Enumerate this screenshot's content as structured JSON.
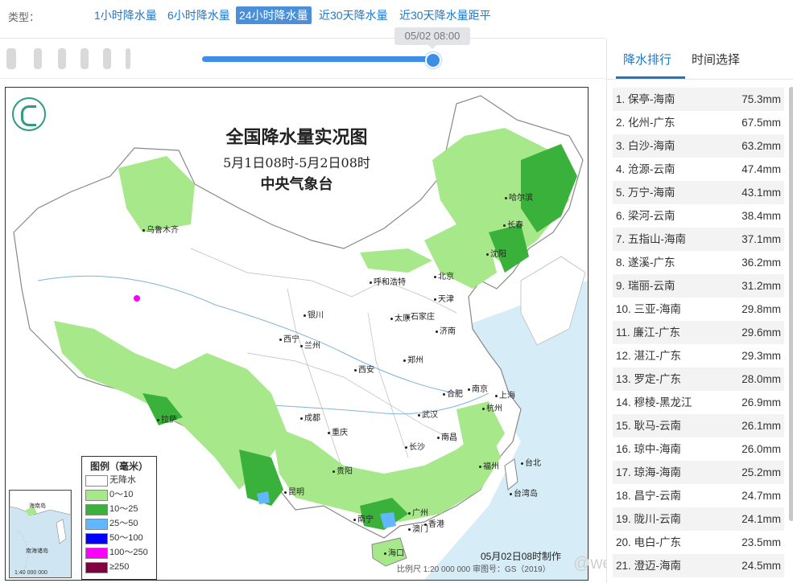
{
  "filter": {
    "type_label": "类型：",
    "tabs": [
      {
        "label": "1小时降水量",
        "active": false
      },
      {
        "label": "6小时降水量",
        "active": false
      },
      {
        "label": "24小时降水量",
        "active": true
      },
      {
        "label": "近30天降水量",
        "active": false
      },
      {
        "label": "近30天降水量距平",
        "active": false
      }
    ]
  },
  "timeline": {
    "selected_time": "05/02 08:00",
    "position_fraction": 1.0
  },
  "map": {
    "title": "全国降水量实况图",
    "period": "5月1日08时-5月2日08时",
    "issuer": "中央气象台",
    "cities": [
      "乌鲁木齐",
      "哈尔滨",
      "长春",
      "沈阳",
      "北京",
      "天津",
      "呼和浩特",
      "银川",
      "太原",
      "石家庄",
      "济南",
      "西宁",
      "兰州",
      "郑州",
      "西安",
      "合肥",
      "南京",
      "上海",
      "杭州",
      "成都",
      "武汉",
      "重庆",
      "南昌",
      "拉萨",
      "长沙",
      "贵阳",
      "福州",
      "台北",
      "昆明",
      "南宁",
      "广州",
      "香港",
      "澳门",
      "海口",
      "台湾岛"
    ],
    "legend_title": "图例（毫米）",
    "legend": [
      {
        "label": "无降水",
        "color": "#ffffff"
      },
      {
        "label": "0～10",
        "color": "#a6e88a"
      },
      {
        "label": "10～25",
        "color": "#39b13a"
      },
      {
        "label": "25～50",
        "color": "#62b8ff"
      },
      {
        "label": "50～100",
        "color": "#0000fe"
      },
      {
        "label": "100～250",
        "color": "#fa00fa"
      },
      {
        "label": "≥250",
        "color": "#800040"
      }
    ],
    "inset_labels": [
      "海南岛",
      "南海诸岛"
    ],
    "inset_scale": "1:40 000 000",
    "made_time": "05月02日08时制作",
    "footer": "比例尺 1:20 000 000    审图号：GS（2019）"
  },
  "watermark": "@weatherman_信欣",
  "ranking": {
    "tabs": [
      {
        "label": "降水排行",
        "active": true
      },
      {
        "label": "时间选择",
        "active": false
      }
    ],
    "items": [
      {
        "rank": "1.",
        "name": "保亭-海南",
        "value": "75.3mm"
      },
      {
        "rank": "2.",
        "name": "化州-广东",
        "value": "67.5mm"
      },
      {
        "rank": "3.",
        "name": "白沙-海南",
        "value": "63.2mm"
      },
      {
        "rank": "4.",
        "name": "沧源-云南",
        "value": "47.4mm"
      },
      {
        "rank": "5.",
        "name": "万宁-海南",
        "value": "43.1mm"
      },
      {
        "rank": "6.",
        "name": "梁河-云南",
        "value": "38.4mm"
      },
      {
        "rank": "7.",
        "name": "五指山-海南",
        "value": "37.1mm"
      },
      {
        "rank": "8.",
        "name": "遂溪-广东",
        "value": "36.2mm"
      },
      {
        "rank": "9.",
        "name": "瑞丽-云南",
        "value": "31.2mm"
      },
      {
        "rank": "10.",
        "name": "三亚-海南",
        "value": "29.8mm"
      },
      {
        "rank": "11.",
        "name": "廉江-广东",
        "value": "29.6mm"
      },
      {
        "rank": "12.",
        "name": "湛江-广东",
        "value": "29.3mm"
      },
      {
        "rank": "13.",
        "name": "罗定-广东",
        "value": "28.0mm"
      },
      {
        "rank": "14.",
        "name": "穆棱-黑龙江",
        "value": "26.9mm"
      },
      {
        "rank": "15.",
        "name": "耿马-云南",
        "value": "26.1mm"
      },
      {
        "rank": "16.",
        "name": "琼中-海南",
        "value": "26.0mm"
      },
      {
        "rank": "17.",
        "name": "琼海-海南",
        "value": "25.2mm"
      },
      {
        "rank": "18.",
        "name": "昌宁-云南",
        "value": "24.7mm"
      },
      {
        "rank": "19.",
        "name": "陇川-云南",
        "value": "24.1mm"
      },
      {
        "rank": "20.",
        "name": "电白-广东",
        "value": "23.5mm"
      },
      {
        "rank": "21.",
        "name": "澄迈-海南",
        "value": "24.5mm"
      }
    ]
  }
}
